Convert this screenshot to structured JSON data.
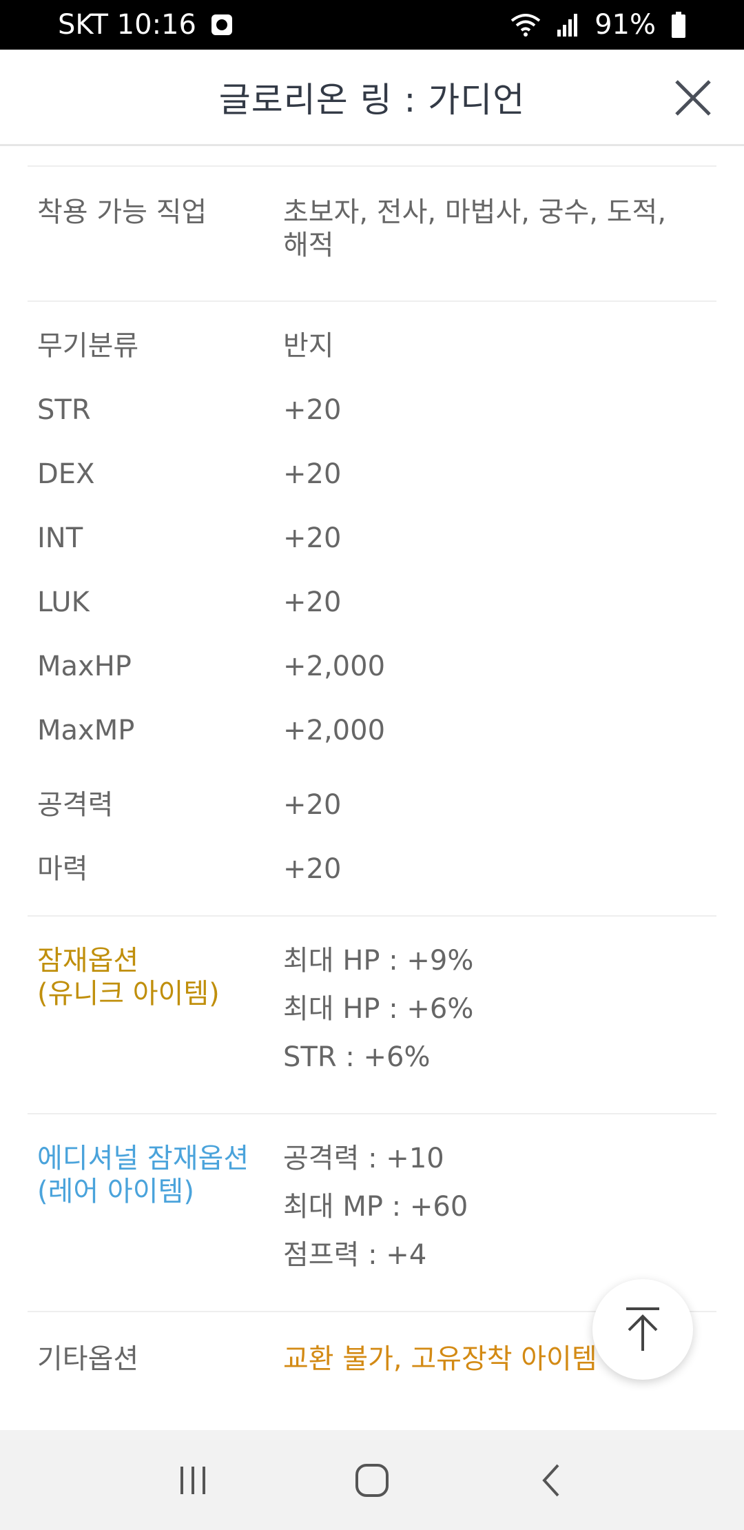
{
  "status_bar": {
    "carrier_time": "SKT 10:16",
    "battery": "91%",
    "icons": [
      "app-notification-icon",
      "wifi-icon",
      "signal-icon",
      "battery-icon"
    ]
  },
  "header": {
    "title": "글로리온 링 : 가디언",
    "close_icon": "close-icon"
  },
  "job": {
    "label": "착용 가능 직업",
    "value_line1": "초보자, 전사, 마법사, 궁수, 도적,",
    "value_line2": "해적"
  },
  "stats": [
    {
      "label": "무기분류",
      "value": "반지"
    },
    {
      "label": "STR",
      "value": "+20"
    },
    {
      "label": "DEX",
      "value": "+20"
    },
    {
      "label": "INT",
      "value": "+20"
    },
    {
      "label": "LUK",
      "value": "+20"
    },
    {
      "label": "MaxHP",
      "value": "+2,000"
    },
    {
      "label": "MaxMP",
      "value": "+2,000"
    },
    {
      "label": "공격력",
      "value": "+20"
    },
    {
      "label": "마력",
      "value": "+20"
    }
  ],
  "potential": {
    "label_line1": "잠재옵션",
    "label_line2": "(유니크 아이템)",
    "values": [
      "최대 HP : +9%",
      "최대 HP : +6%",
      "STR : +6%"
    ],
    "color": "#c08f0c"
  },
  "additional_potential": {
    "label_line1": "에디셔널 잠재옵션",
    "label_line2": "(레어 아이템)",
    "values": [
      "공격력 : +10",
      "최대 MP : +60",
      "점프력 : +4"
    ],
    "color": "#4aa3db"
  },
  "other": {
    "label": "기타옵션",
    "value": "교환 불가, 고유장착 아이템",
    "color": "#d38a14"
  },
  "nav": {
    "icons": [
      "recent-apps-icon",
      "home-icon",
      "back-icon"
    ]
  }
}
